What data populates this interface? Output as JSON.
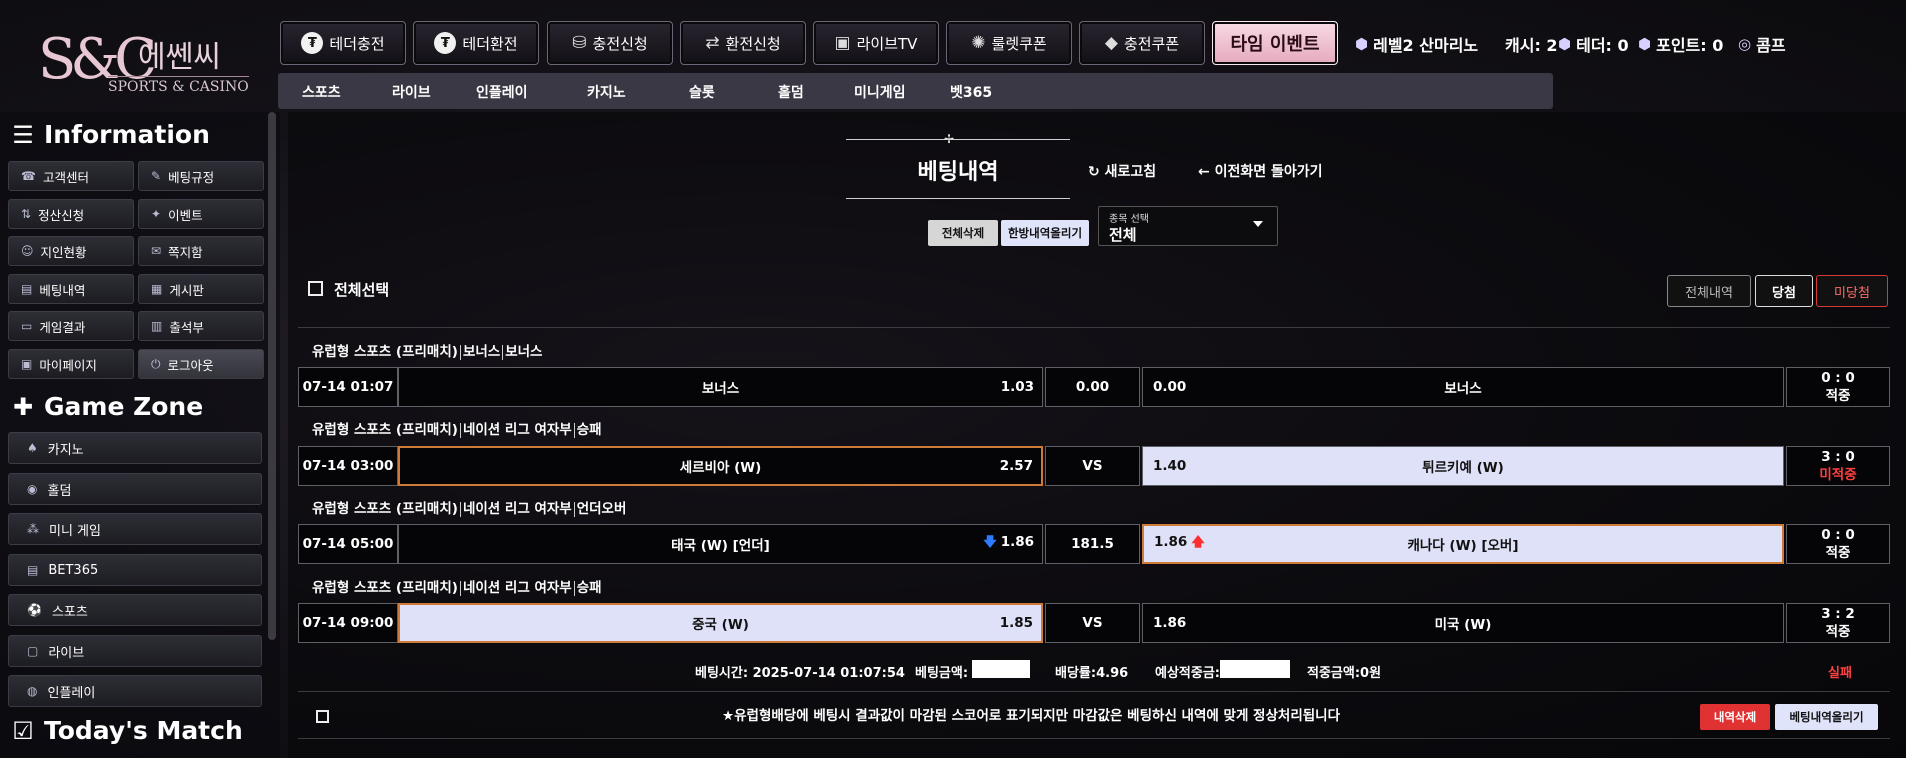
{
  "brand": {
    "monogram": "S&C",
    "korean": "에쎈씨",
    "english": "SPORTS & CASINO"
  },
  "top_nav": [
    {
      "label": "테더충전",
      "icon": "tether-icon"
    },
    {
      "label": "테더환전",
      "icon": "tether-icon"
    },
    {
      "label": "충전신청",
      "icon": "coins-icon"
    },
    {
      "label": "환전신청",
      "icon": "exchange-icon"
    },
    {
      "label": "라이브TV",
      "icon": "live-tv-icon"
    },
    {
      "label": "룰렛쿠폰",
      "icon": "roulette-icon"
    },
    {
      "label": "충전쿠폰",
      "icon": "coupon-icon"
    }
  ],
  "time_event": "타임 이벤트",
  "user_stats": {
    "level": "레벨2 산마리노",
    "cash": "캐시: 2",
    "tether": "테더: 0",
    "points": "포인트: 0",
    "comp": "콤프"
  },
  "sub_nav": [
    "스포츠",
    "라이브",
    "인플레이",
    "카지노",
    "슬롯",
    "홀덤",
    "미니게임",
    "벳365"
  ],
  "sidebar": {
    "info_title": "Information",
    "info_items": [
      {
        "label": "고객센터",
        "icon": "phone-icon"
      },
      {
        "label": "베팅규정",
        "icon": "rules-icon"
      },
      {
        "label": "정산신청",
        "icon": "settlement-icon"
      },
      {
        "label": "이벤트",
        "icon": "event-icon"
      },
      {
        "label": "지인현황",
        "icon": "friends-icon"
      },
      {
        "label": "쪽지함",
        "icon": "message-icon"
      },
      {
        "label": "베팅내역",
        "icon": "betting-history-icon"
      },
      {
        "label": "게시판",
        "icon": "board-icon"
      },
      {
        "label": "게임결과",
        "icon": "game-result-icon"
      },
      {
        "label": "출석부",
        "icon": "attendance-icon"
      },
      {
        "label": "마이페이지",
        "icon": "user-icon"
      },
      {
        "label": "로그아웃",
        "icon": "power-icon"
      }
    ],
    "game_title": "Game Zone",
    "game_items": [
      {
        "label": "카지노",
        "icon": "spade-icon"
      },
      {
        "label": "홀덤",
        "icon": "chip-icon"
      },
      {
        "label": "미니 게임",
        "icon": "mini-game-icon"
      },
      {
        "label": "BET365",
        "icon": "bet365-icon"
      },
      {
        "label": "스포츠",
        "icon": "sports-icon"
      },
      {
        "label": "라이브",
        "icon": "live-icon"
      },
      {
        "label": "인플레이",
        "icon": "inplay-icon"
      }
    ],
    "today_title": "Today's Match"
  },
  "page": {
    "title": "베팅내역",
    "refresh": "새로고침",
    "back": "이전화면 돌아가기",
    "delete_all": "전체삭제",
    "upload_all": "한방내역올리기",
    "sport_select_label": "종목 선택",
    "sport_select_value": "전체",
    "select_all": "전체선택",
    "filters": [
      "전체내역",
      "당첨",
      "미당첨"
    ]
  },
  "bets": [
    {
      "category": [
        "유럽형 스포츠 (프리매치)",
        "보너스",
        "보너스"
      ],
      "time": "07-14 01:07",
      "home": "보너스",
      "home_odd": "1.03",
      "mid": "0.00",
      "away_odd": "0.00",
      "away": "보너스",
      "score": "0 : 0",
      "status": "적중"
    },
    {
      "category": [
        "유럽형 스포츠 (프리매치)",
        "네이션 리그 여자부",
        "승패"
      ],
      "time": "07-14 03:00",
      "home": "세르비아 (W)",
      "home_odd": "2.57",
      "mid": "VS",
      "away_odd": "1.40",
      "away": "튀르키예 (W)",
      "score": "3 : 0",
      "status": "미적중"
    },
    {
      "category": [
        "유럽형 스포츠 (프리매치)",
        "네이션 리그 여자부",
        "언더오버"
      ],
      "time": "07-14 05:00",
      "home": "태국 (W) [언더]",
      "home_odd": "1.86",
      "mid": "181.5",
      "away_odd": "1.86",
      "away": "캐나다 (W) [오버]",
      "score": "0 : 0",
      "status": "적중"
    },
    {
      "category": [
        "유럽형 스포츠 (프리매치)",
        "네이션 리그 여자부",
        "승패"
      ],
      "time": "07-14 09:00",
      "home": "중국 (W)",
      "home_odd": "1.85",
      "mid": "VS",
      "away_odd": "1.86",
      "away": "미국 (W)",
      "score": "3 : 2",
      "status": "적중"
    }
  ],
  "summary": {
    "bet_time": "베팅시간: 2025-07-14 01:07:54",
    "bet_amount": "베팅금액:",
    "odds": "배당률:4.96",
    "expected": "예상적중금:",
    "won": "적중금액:0원",
    "result": "실패"
  },
  "notice": "★유럽형배당에 베팅시 결과값이 마감된 스코어로 표기되지만 마감값은 베팅하신 내역에 맞게 정상처리됩니다",
  "row_actions": {
    "delete": "내역삭제",
    "upload": "베팅내역올리기"
  },
  "colors": {
    "accent_pink": "#e6a9bd",
    "lose_red": "#ff4040",
    "selected_bg": "#dfe1f8",
    "highlight_border": "#d07a3a"
  }
}
